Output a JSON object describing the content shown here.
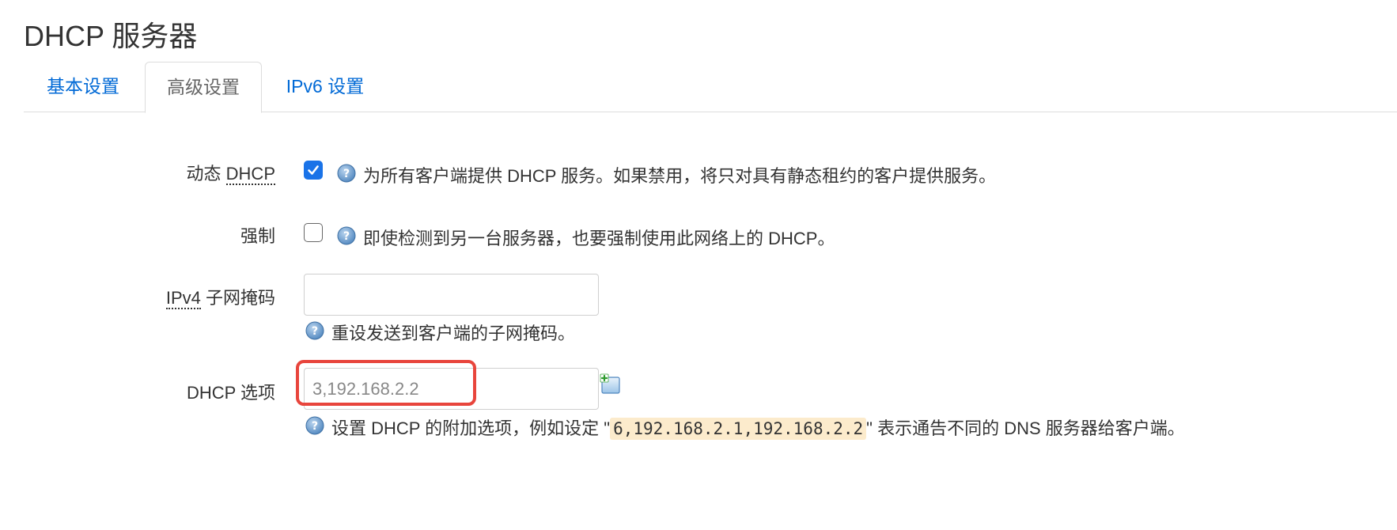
{
  "page": {
    "title": "DHCP 服务器"
  },
  "tabs": [
    {
      "label": "基本设置",
      "active": false
    },
    {
      "label": "高级设置",
      "active": true
    },
    {
      "label": "IPv6 设置",
      "active": false
    }
  ],
  "fields": {
    "dynamic_dhcp": {
      "label_prefix": "动态 ",
      "label_abbr": "DHCP",
      "checked": true,
      "help": "为所有客户端提供 DHCP 服务。如果禁用，将只对具有静态租约的客户提供服务。"
    },
    "force": {
      "label": "强制",
      "checked": false,
      "help": "即使检测到另一台服务器，也要强制使用此网络上的 DHCP。"
    },
    "ipv4_netmask": {
      "label_abbr": "IPv4",
      "label_suffix": " 子网掩码",
      "value": "",
      "help": "重设发送到客户端的子网掩码。"
    },
    "dhcp_options": {
      "label": "DHCP 选项",
      "placeholder": "3,192.168.2.2",
      "help_before": "设置 DHCP 的附加选项，例如设定 \"",
      "help_code": "6,192.168.2.1,192.168.2.2",
      "help_after": "\" 表示通告不同的 DNS 服务器给客户端。"
    }
  },
  "colors": {
    "link": "#0069d6",
    "checkbox_checked": "#1a73e8",
    "highlight": "#e8453c",
    "code_bg": "#fcebcc"
  },
  "icons": {
    "help": "help-question-icon",
    "add": "add-option-icon"
  }
}
